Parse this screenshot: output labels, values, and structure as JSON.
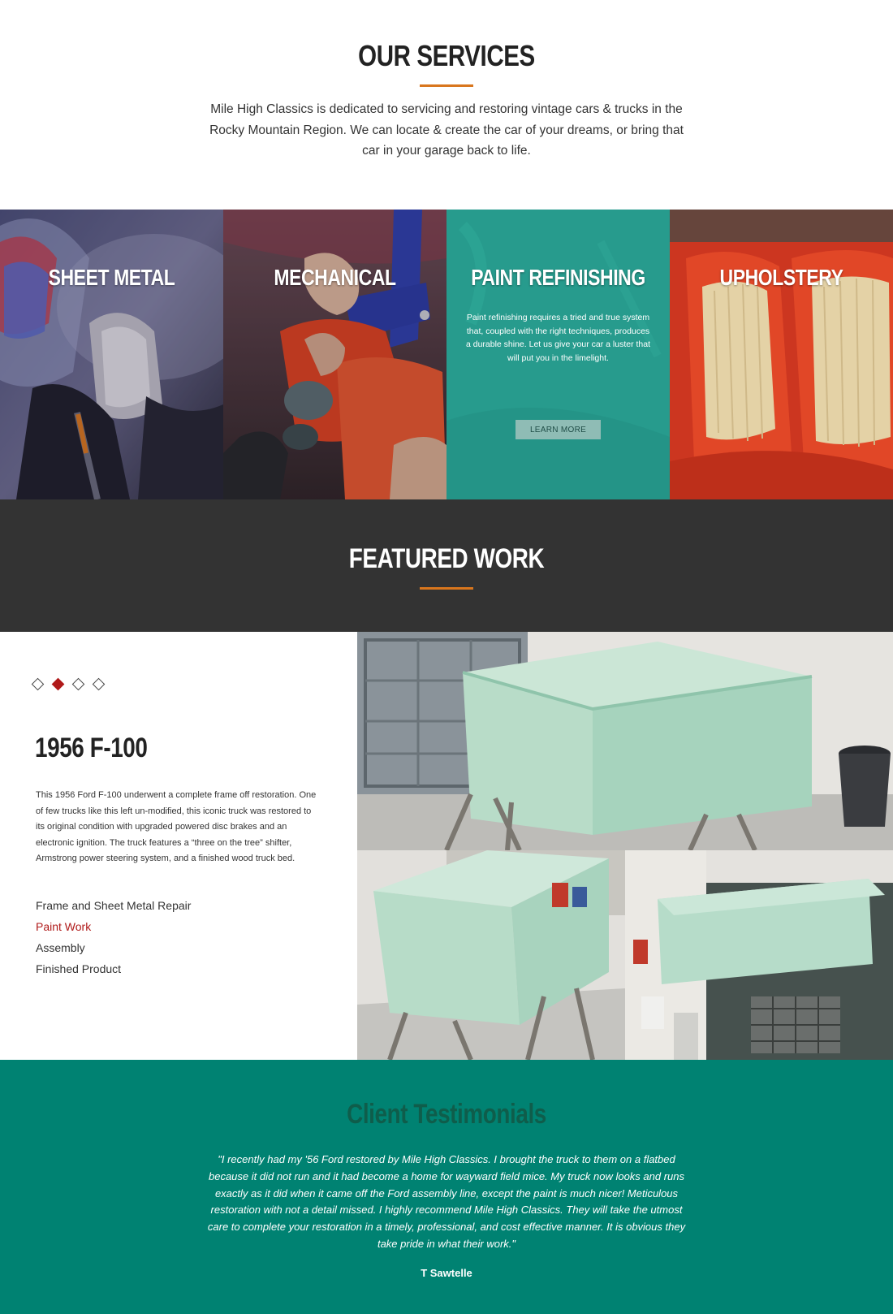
{
  "services": {
    "title": "OUR SERVICES",
    "description": "Mile High Classics is dedicated to servicing and restoring vintage cars & trucks in the Rocky Mountain Region. We can locate & create the car of your dreams, or bring that car in your garage back to life.",
    "accent_color": "#d9761d"
  },
  "tiles": [
    {
      "title": "SHEET METAL"
    },
    {
      "title": "MECHANICAL"
    },
    {
      "title": "PAINT REFINISHING",
      "text": "Paint refinishing requires a tried and true system that, coupled with the right techniques, produces a durable shine. Let us give your car a luster that will put you in the limelight.",
      "button": "LEARN MORE",
      "overlay_color": "#279b8d"
    },
    {
      "title": "UPHOLSTERY"
    }
  ],
  "featured": {
    "title": "FEATURED WORK",
    "band_color": "#333333"
  },
  "work": {
    "title": "1956 F-100",
    "description": "This 1956 Ford F-100 underwent a complete frame off restoration. One of few trucks like this left un-modified, this iconic truck was restored to its original condition with upgraded powered disc brakes and an electronic ignition. The truck features a “three on the tree” shifter, Armstrong power steering system, and a finished wood truck bed.",
    "slide_count": 4,
    "active_slide": 2,
    "steps": [
      "Frame and Sheet Metal Repair",
      "Paint Work",
      "Assembly",
      "Finished Product"
    ],
    "active_step": 1,
    "highlight_color": "#b01a1a"
  },
  "testimonials": {
    "title": "Client Testimonials",
    "quote": "\"I recently had my '56 Ford restored by Mile High Classics. I brought the truck to them on a flatbed because it did not run and it had become a home for wayward field mice. My truck now looks and runs exactly as it did when it came off the Ford assembly line, except the paint is much nicer! Meticulous restoration with not a detail missed. I highly recommend Mile High Classics. They will take the utmost care to complete your restoration in a timely, professional, and cost effective manner. It is obvious they take pride in what their work.\"",
    "author": "T Sawtelle",
    "background": "#008272"
  }
}
